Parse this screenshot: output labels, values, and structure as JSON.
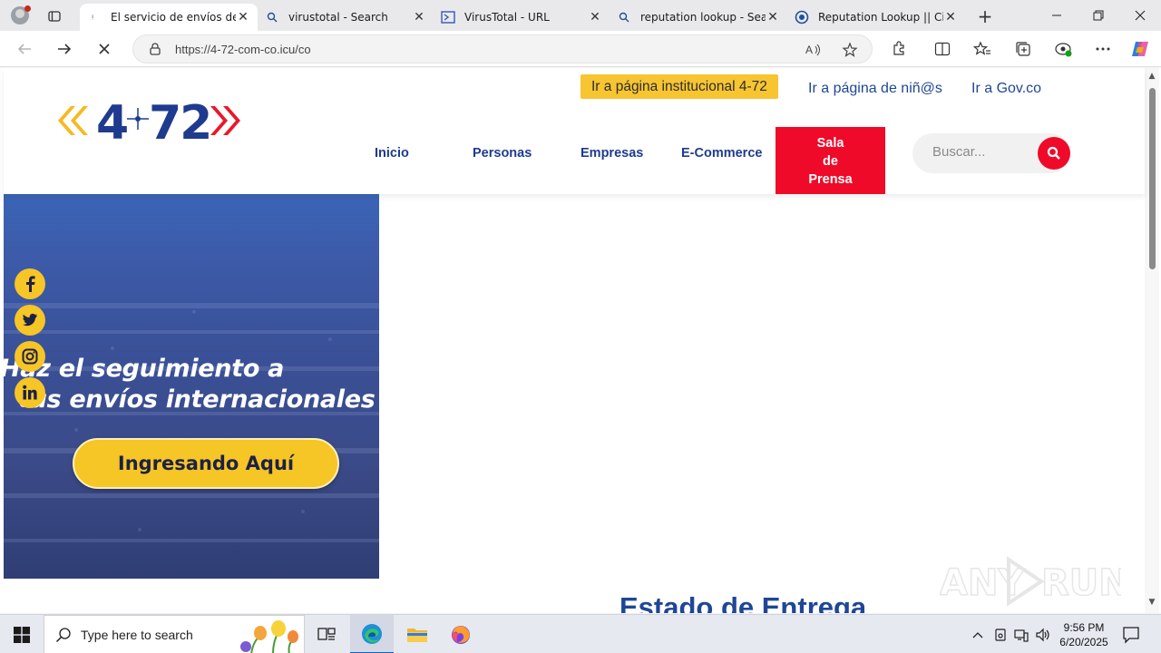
{
  "browser": {
    "tabs": [
      {
        "title": "El servicio de envíos de C",
        "active": true
      },
      {
        "title": "virustotal - Search",
        "active": false
      },
      {
        "title": "VirusTotal - URL",
        "active": false
      },
      {
        "title": "reputation lookup - Searc",
        "active": false
      },
      {
        "title": "Reputation Lookup || Cisc",
        "active": false
      }
    ],
    "url": "https://4-72-com-co.icu/co"
  },
  "site": {
    "logo_text": "4-72",
    "top_links": {
      "institutional": "Ir a página institucional 4-72",
      "kids": "Ir a página de niñ@s",
      "gov": "Ir a Gov.co"
    },
    "nav": [
      {
        "label": "Inicio"
      },
      {
        "label": "Personas"
      },
      {
        "label": "Empresas"
      },
      {
        "label": "E-Commerce"
      }
    ],
    "sala_prensa": {
      "line1": "Sala",
      "line2": "de",
      "line3": "Prensa"
    },
    "search_placeholder": "Buscar...",
    "banner": {
      "line1": "Haz el seguimiento a",
      "line2": "tus envíos internacionales",
      "cta": "Ingresando Aquí"
    },
    "social": [
      {
        "icon": "facebook-icon"
      },
      {
        "icon": "twitter-icon"
      },
      {
        "icon": "instagram-icon"
      },
      {
        "icon": "linkedin-icon"
      }
    ],
    "section_heading": "Estado de Entrega"
  },
  "watermark": "ANY RUN",
  "taskbar": {
    "search_placeholder": "Type here to search",
    "time": "9:56 PM",
    "date": "6/20/2025"
  },
  "colors": {
    "brand_blue": "#1f3b8f",
    "brand_red": "#ef0a2a",
    "brand_yellow": "#f6c526"
  }
}
